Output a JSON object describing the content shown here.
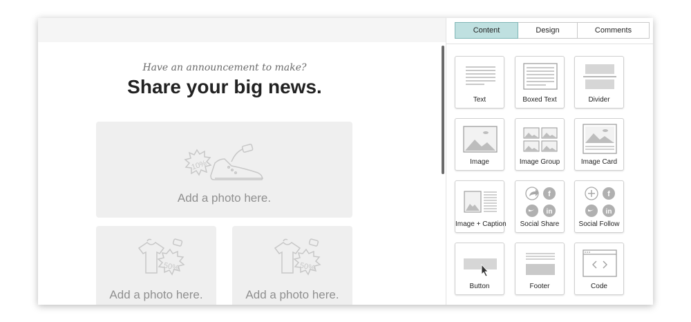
{
  "editor": {
    "preheader": "Have an announcement to make?",
    "headline": "Share your big news.",
    "photo_placeholders": [
      {
        "caption": "Add a photo here.",
        "illustration": "shoe-sale-icon",
        "tag_text": "10%"
      },
      {
        "caption": "Add a photo here.",
        "illustration": "shirt-sale-icon",
        "tag_text": "50%"
      },
      {
        "caption": "Add a photo here.",
        "illustration": "shirt-sale-icon",
        "tag_text": "50%"
      }
    ]
  },
  "panel": {
    "tabs": [
      {
        "label": "Content",
        "active": true
      },
      {
        "label": "Design",
        "active": false
      },
      {
        "label": "Comments",
        "active": false
      }
    ],
    "blocks": [
      {
        "label": "Text",
        "icon": "text-block-icon"
      },
      {
        "label": "Boxed Text",
        "icon": "boxed-text-block-icon"
      },
      {
        "label": "Divider",
        "icon": "divider-block-icon"
      },
      {
        "label": "Image",
        "icon": "image-block-icon"
      },
      {
        "label": "Image Group",
        "icon": "image-group-block-icon"
      },
      {
        "label": "Image Card",
        "icon": "image-card-block-icon"
      },
      {
        "label": "Image + Caption",
        "icon": "image-caption-block-icon"
      },
      {
        "label": "Social Share",
        "icon": "social-share-block-icon"
      },
      {
        "label": "Social Follow",
        "icon": "social-follow-block-icon"
      },
      {
        "label": "Button",
        "icon": "button-block-icon"
      },
      {
        "label": "Footer",
        "icon": "footer-block-icon"
      },
      {
        "label": "Code",
        "icon": "code-block-icon"
      }
    ]
  },
  "colors": {
    "active_tab": "#bfe0e0",
    "placeholder_bg": "#efefef",
    "icon_gray": "#b5b5b5"
  }
}
